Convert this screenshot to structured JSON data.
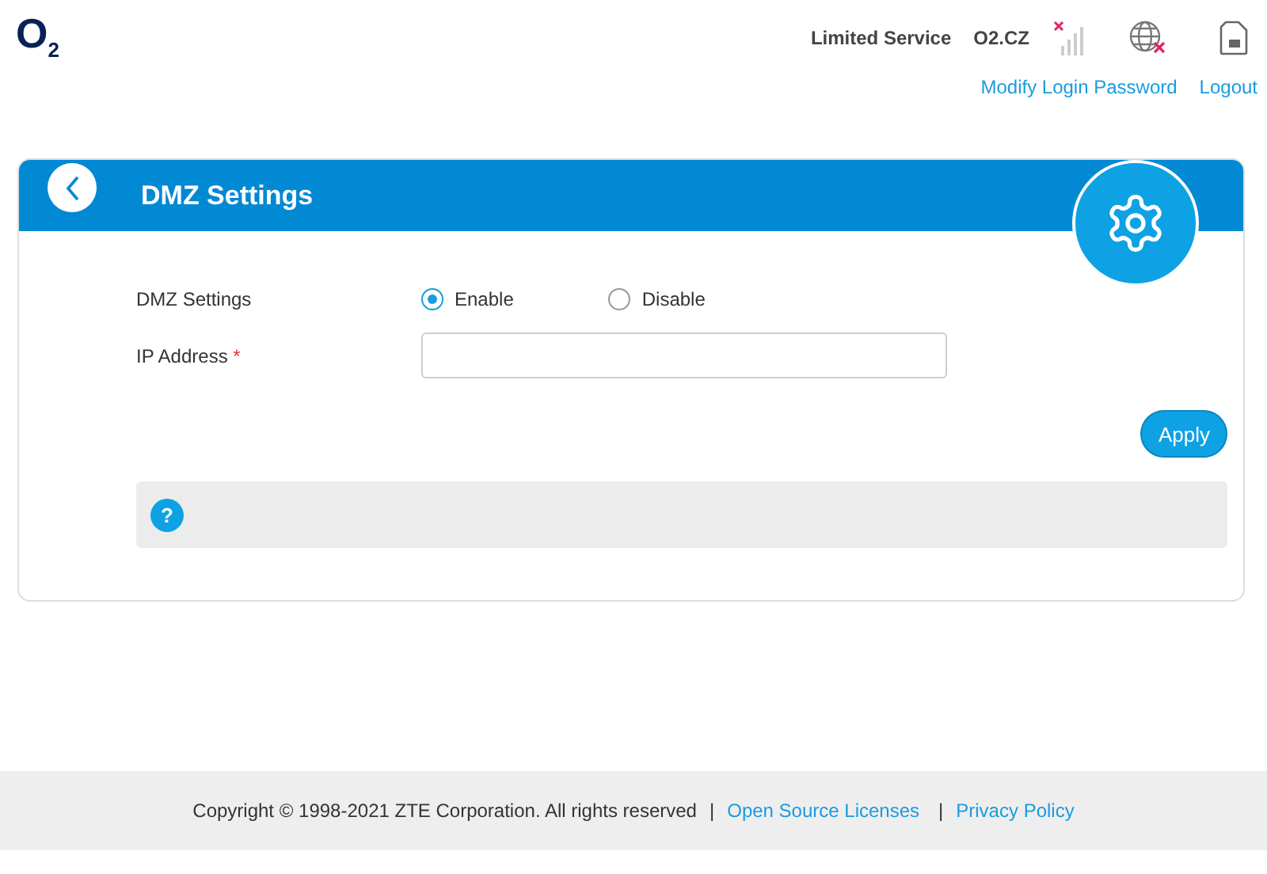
{
  "logo": "O$_{2}$",
  "status": {
    "service": "Limited Service",
    "operator": "O2.CZ"
  },
  "header_links": [
    "Modify Login Password",
    "Logout"
  ],
  "panel": {
    "title": "DMZ Settings",
    "fields": [
      {
        "kind": "radio",
        "label": "DMZ Settings",
        "options": [
          {
            "label": "Enable",
            "selected": true
          },
          {
            "label": "Disable",
            "selected": false
          }
        ]
      },
      {
        "kind": "input",
        "label": "IP Address",
        "required_mark": "*"
      }
    ],
    "apply": "Apply",
    "help_icon": "?"
  },
  "footer": {
    "copyright": "Copyright © 1998-2021 ZTE Corporation. All rights reserved",
    "separators": [
      "|",
      "|"
    ],
    "links": [
      "Open Source Licenses",
      "Privacy Policy"
    ]
  }
}
